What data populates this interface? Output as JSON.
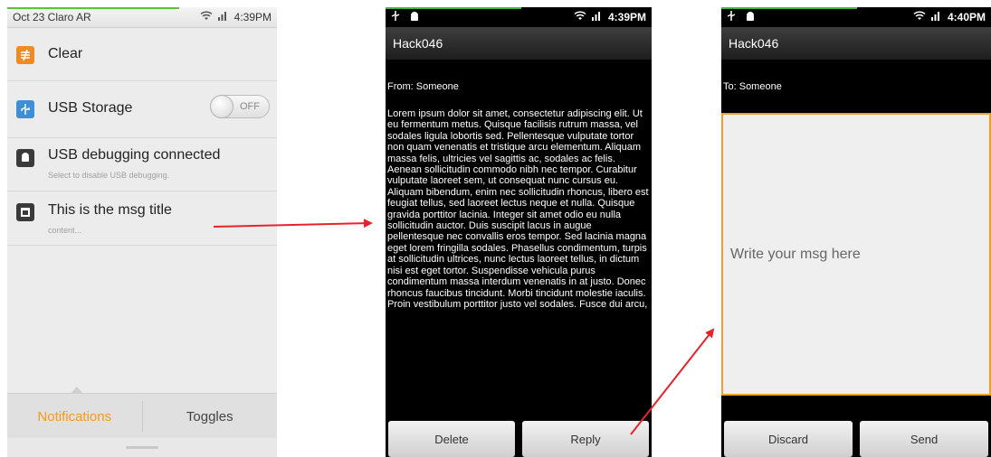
{
  "colors": {
    "arrow": "#e8222a",
    "active_tab": "#f39c1b",
    "input_border": "#f0a02a"
  },
  "notification_screen": {
    "status_bar": {
      "left": "Oct 23  Claro AR",
      "time": "4:39PM"
    },
    "rows": [
      {
        "title": "Clear",
        "icon": "clear-icon"
      },
      {
        "title": "USB Storage",
        "icon": "usb-icon",
        "toggle": "OFF"
      },
      {
        "title": "USB debugging connected",
        "subtitle": "Select to disable USB debugging.",
        "icon": "android-debug-icon"
      },
      {
        "title": "This is the msg title",
        "subtitle": "content...",
        "icon": "app-icon"
      }
    ],
    "tabs": {
      "notifications": "Notifications",
      "toggles": "Toggles"
    }
  },
  "read_screen": {
    "status_time": "4:39PM",
    "title": "Hack046",
    "from": "From: Someone",
    "body": "Lorem ipsum dolor sit amet, consectetur adipiscing elit. Ut eu fermentum metus. Quisque facilisis rutrum massa, vel sodales ligula lobortis sed. Pellentesque vulputate tortor non quam venenatis et tristique arcu elementum. Aliquam massa felis, ultricies vel sagittis ac, sodales ac felis. Aenean sollicitudin commodo nibh nec tempor. Curabitur vulputate laoreet sem, ut consequat nunc cursus eu. Aliquam bibendum, enim nec sollicitudin rhoncus, libero est feugiat tellus, sed laoreet lectus neque et nulla. Quisque gravida porttitor lacinia. Integer sit amet odio eu nulla sollicitudin auctor. Duis suscipit lacus in augue pellentesque nec convallis eros tempor. Sed lacinia magna eget lorem fringilla sodales. Phasellus condimentum, turpis at sollicitudin ultrices, nunc lectus laoreet tellus, in dictum nisi est eget tortor. Suspendisse vehicula purus condimentum massa interdum venenatis in at justo. Donec rhoncus faucibus tincidunt. Morbi tincidunt molestie iaculis. Proin vestibulum porttitor justo vel sodales. Fusce dui arcu,",
    "buttons": {
      "delete": "Delete",
      "reply": "Reply"
    }
  },
  "compose_screen": {
    "status_time": "4:40PM",
    "title": "Hack046",
    "to": "To: Someone",
    "placeholder": "Write your msg here",
    "buttons": {
      "discard": "Discard",
      "send": "Send"
    }
  }
}
